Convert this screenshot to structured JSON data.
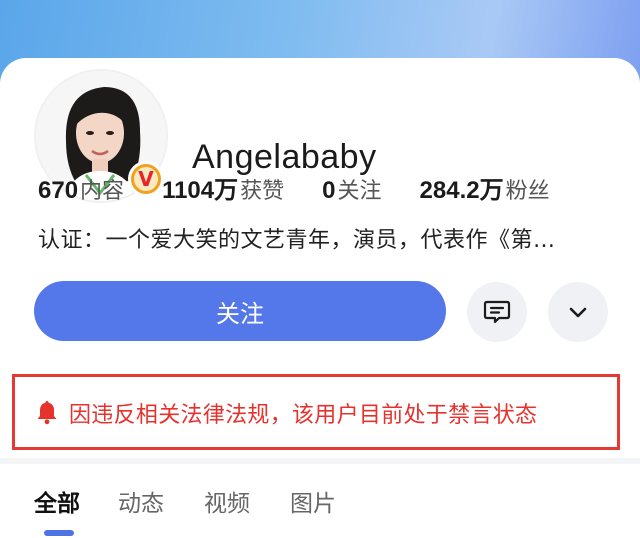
{
  "profile": {
    "username": "Angelababy",
    "verified_badge_letter": "V",
    "stats": [
      {
        "num": "670",
        "label": "内容"
      },
      {
        "num": "1104万",
        "label": "获赞"
      },
      {
        "num": "0",
        "label": "关注"
      },
      {
        "num": "284.2万",
        "label": "粉丝"
      }
    ],
    "bio": "认证：一个爱大笑的文艺青年，演员，代表作《第…"
  },
  "actions": {
    "follow_label": "关注",
    "message_icon": "message-icon",
    "more_icon": "chevron-down-icon"
  },
  "alert": {
    "icon": "bell-icon",
    "text": "因违反相关法律法规，该用户目前处于禁言状态"
  },
  "tabs": [
    {
      "label": "全部",
      "active": true
    },
    {
      "label": "动态",
      "active": false
    },
    {
      "label": "视频",
      "active": false
    },
    {
      "label": "图片",
      "active": false
    }
  ],
  "colors": {
    "accent": "#5478ea",
    "alert": "#e5322d",
    "badge": "#f0a21f"
  }
}
